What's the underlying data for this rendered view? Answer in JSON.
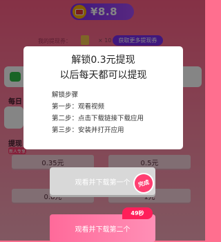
{
  "header": {
    "balance": "¥8.8"
  },
  "coupons": {
    "label": "我的提现券：",
    "count": "× 10",
    "get_more_label": "获取更多提现券"
  },
  "sections": {
    "daily": "每日",
    "withdraw": "提现",
    "new_user_tag": "新人专享"
  },
  "withdraw_options": [
    "0.35元",
    "0.5元",
    "0.8元",
    "1元"
  ],
  "modal": {
    "title_line1": "解锁0.3元提现",
    "title_line2": "以后每天都可以提现",
    "steps_title": "解锁步骤",
    "step1": "第一步：观看视频",
    "step2": "第二步：点击下载链接下载应用",
    "step3": "第三步：安装并打开应用"
  },
  "actions": {
    "watch_first": "观看并下载第一个",
    "done_badge": "完成",
    "watch_second": "观看并下载第二个",
    "timer": "49秒"
  },
  "colors": {
    "accent": "#7b2df0",
    "pink": "#ff3f72"
  }
}
